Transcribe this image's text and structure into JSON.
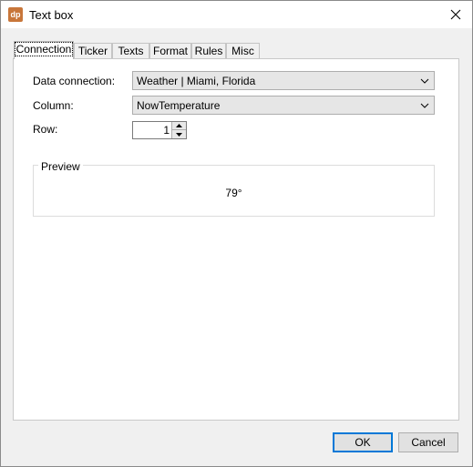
{
  "window": {
    "title": "Text box",
    "app_icon_text": "dp",
    "accent_color": "#0078d7",
    "icon_color": "#c8763a"
  },
  "tabs": [
    {
      "label": "Connection",
      "active": true
    },
    {
      "label": "Ticker",
      "active": false
    },
    {
      "label": "Texts",
      "active": false
    },
    {
      "label": "Format",
      "active": false
    },
    {
      "label": "Rules",
      "active": false
    },
    {
      "label": "Misc",
      "active": false
    }
  ],
  "form": {
    "data_connection_label": "Data connection:",
    "data_connection_value": "Weather | Miami, Florida",
    "column_label": "Column:",
    "column_value": "NowTemperature",
    "row_label": "Row:",
    "row_value": "1"
  },
  "preview": {
    "title": "Preview",
    "value": "79°"
  },
  "buttons": {
    "ok_label": "OK",
    "cancel_label": "Cancel"
  },
  "icons": {
    "close": "close-icon",
    "dropdown": "chevron-down-icon",
    "spin_up": "triangle-up-icon",
    "spin_down": "triangle-down-icon"
  }
}
